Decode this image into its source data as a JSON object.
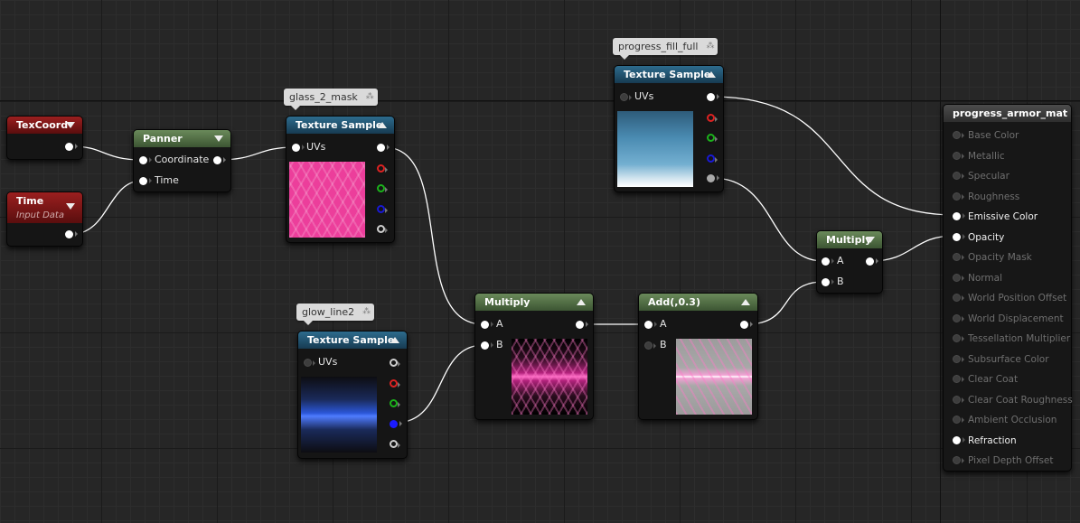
{
  "nodes": {
    "texcoord": {
      "title": "TexCoord"
    },
    "time": {
      "title": "Time",
      "subtitle": "Input Data"
    },
    "panner": {
      "title": "Panner",
      "inputs": [
        "Coordinate",
        "Time"
      ]
    },
    "tex_glass": {
      "title": "Texture Sample",
      "comment": "glass_2_mask",
      "input": "UVs"
    },
    "tex_progress": {
      "title": "Texture Sample",
      "comment": "progress_fill_full",
      "input": "UVs"
    },
    "tex_glow": {
      "title": "Texture Sample",
      "comment": "glow_line2",
      "input": "UVs"
    },
    "multiply_mid": {
      "title": "Multiply",
      "inputs": [
        "A",
        "B"
      ]
    },
    "add": {
      "title": "Add(,0.3)",
      "inputs": [
        "A",
        "B"
      ]
    },
    "multiply_right": {
      "title": "Multiply",
      "inputs": [
        "A",
        "B"
      ]
    }
  },
  "result": {
    "title": "progress_armor_mat",
    "inputs": [
      {
        "label": "Base Color",
        "active": false
      },
      {
        "label": "Metallic",
        "active": false
      },
      {
        "label": "Specular",
        "active": false
      },
      {
        "label": "Roughness",
        "active": false
      },
      {
        "label": "Emissive Color",
        "active": true
      },
      {
        "label": "Opacity",
        "active": true
      },
      {
        "label": "Opacity Mask",
        "active": false
      },
      {
        "label": "Normal",
        "active": false
      },
      {
        "label": "World Position Offset",
        "active": false
      },
      {
        "label": "World Displacement",
        "active": false
      },
      {
        "label": "Tessellation Multiplier",
        "active": false
      },
      {
        "label": "Subsurface Color",
        "active": false
      },
      {
        "label": "Clear Coat",
        "active": false
      },
      {
        "label": "Clear Coat Roughness",
        "active": false
      },
      {
        "label": "Ambient Occlusion",
        "active": false
      },
      {
        "label": "Refraction",
        "active": true
      },
      {
        "label": "Pixel Depth Offset",
        "active": false
      }
    ]
  },
  "colors": {
    "wire": "#ffffff",
    "header_red": "#9b1f1f",
    "header_green": "#5c7d4e",
    "header_blue": "#245a79"
  }
}
